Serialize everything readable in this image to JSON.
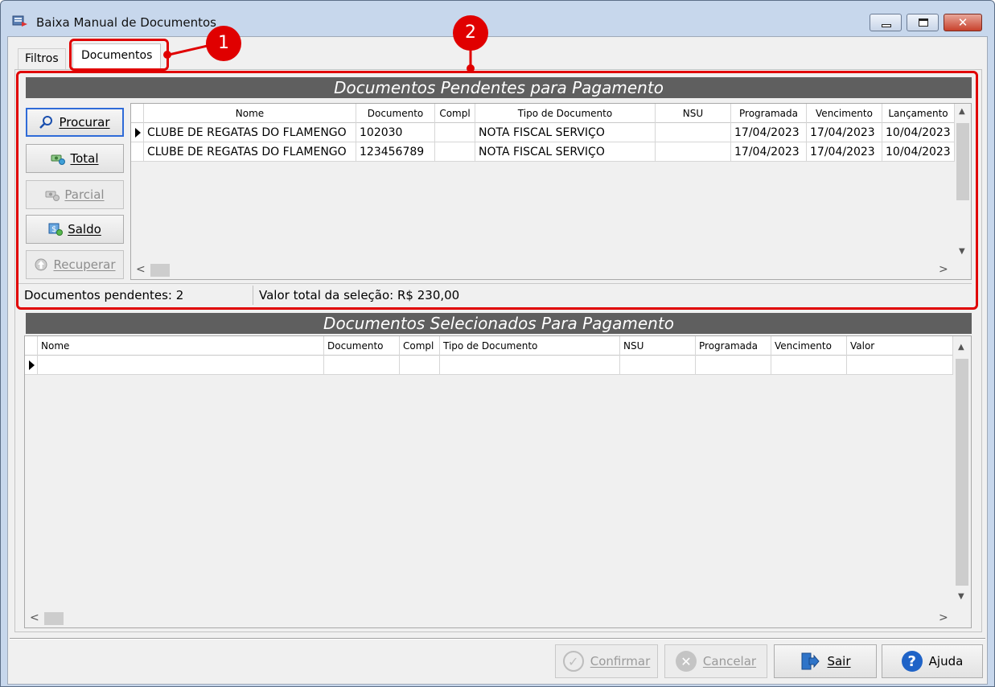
{
  "window": {
    "title": "Baixa Manual de Documentos",
    "close_glyph": "✕"
  },
  "tabs": [
    {
      "label": "Filtros"
    },
    {
      "label": "Documentos"
    }
  ],
  "pending": {
    "header": "Documentos Pendentes para Pagamento",
    "buttons": {
      "procurar": "Procurar",
      "total": "Total",
      "parcial": "Parcial",
      "saldo": "Saldo",
      "recuperar": "Recuperar"
    },
    "columns": [
      "Nome",
      "Documento",
      "Compl",
      "Tipo de Documento",
      "NSU",
      "Programada",
      "Vencimento",
      "Lançamento"
    ],
    "rows": [
      {
        "nome": "CLUBE DE REGATAS DO FLAMENGO",
        "documento": "102030",
        "compl": "",
        "tipo": "NOTA FISCAL SERVIÇO",
        "nsu": "",
        "programada": "17/04/2023",
        "vencimento": "17/04/2023",
        "lancamento": "10/04/2023"
      },
      {
        "nome": "CLUBE DE REGATAS DO FLAMENGO",
        "documento": "123456789",
        "compl": "",
        "tipo": "NOTA FISCAL SERVIÇO",
        "nsu": "",
        "programada": "17/04/2023",
        "vencimento": "17/04/2023",
        "lancamento": "10/04/2023"
      }
    ],
    "status": {
      "pendentes": "Documentos pendentes: 2",
      "valor_total": "Valor total da seleção: R$ 230,00"
    }
  },
  "selected": {
    "header": "Documentos Selecionados Para Pagamento",
    "columns": [
      "Nome",
      "Documento",
      "Compl",
      "Tipo de Documento",
      "NSU",
      "Programada",
      "Vencimento",
      "Valor"
    ]
  },
  "footer": {
    "confirmar": "Confirmar",
    "cancelar": "Cancelar",
    "sair": "Sair",
    "ajuda": "Ajuda"
  },
  "annotations": {
    "badge1": "1",
    "badge2": "2",
    "color": "#e00000"
  },
  "icons": {
    "app": "app-icon",
    "scroll_up": "▲",
    "scroll_down": "▼",
    "scroll_left": "<",
    "scroll_right": ">"
  }
}
